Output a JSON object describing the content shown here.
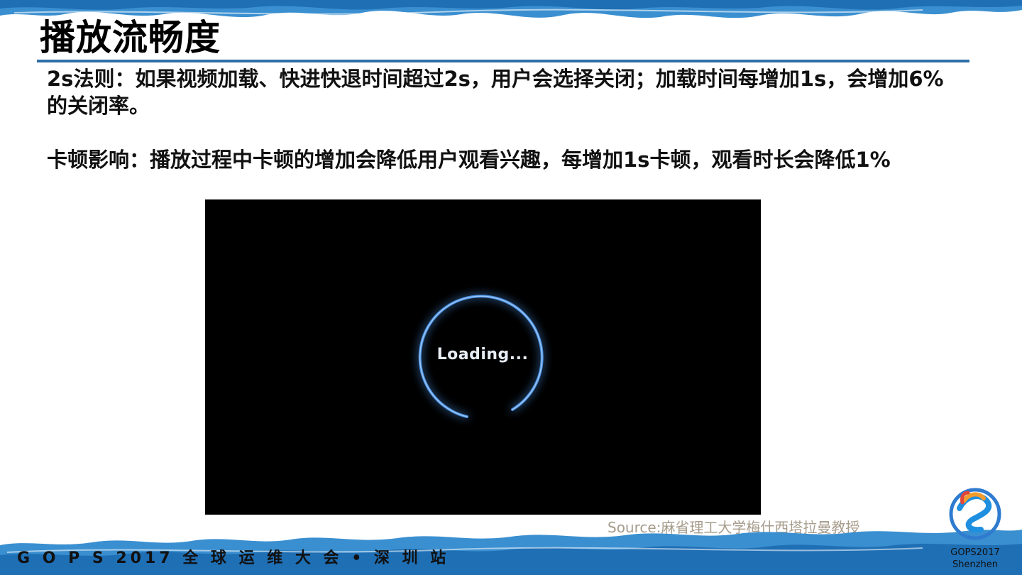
{
  "slide": {
    "title": "播放流畅度",
    "bullets": [
      "2s法则：如果视频加载、快进快退时间超过2s，用户会选择关闭；加载时间每增加1s，会增加6%的关闭率。",
      "卡顿影响：播放过程中卡顿的增加会降低用户观看兴趣，每增加1s卡顿，观看时长会降低1%"
    ],
    "image": {
      "loading_text": "Loading...",
      "icon": "loading-spinner-icon"
    },
    "source": "Source:麻省理工大学梅什西塔拉曼教授"
  },
  "footer": {
    "conference": "G O P S 2017 全 球 运 维 大 会 • 深 圳 站",
    "logo_line1": "GOPS2017",
    "logo_line2": "Shenzhen",
    "logo_icon": "gops-logo-icon"
  },
  "colors": {
    "accent_blue": "#2e6ea6",
    "brush_blue": "#3a8fd0",
    "source_gray": "#a69c8c",
    "spinner_blue": "#4a8fe0"
  }
}
